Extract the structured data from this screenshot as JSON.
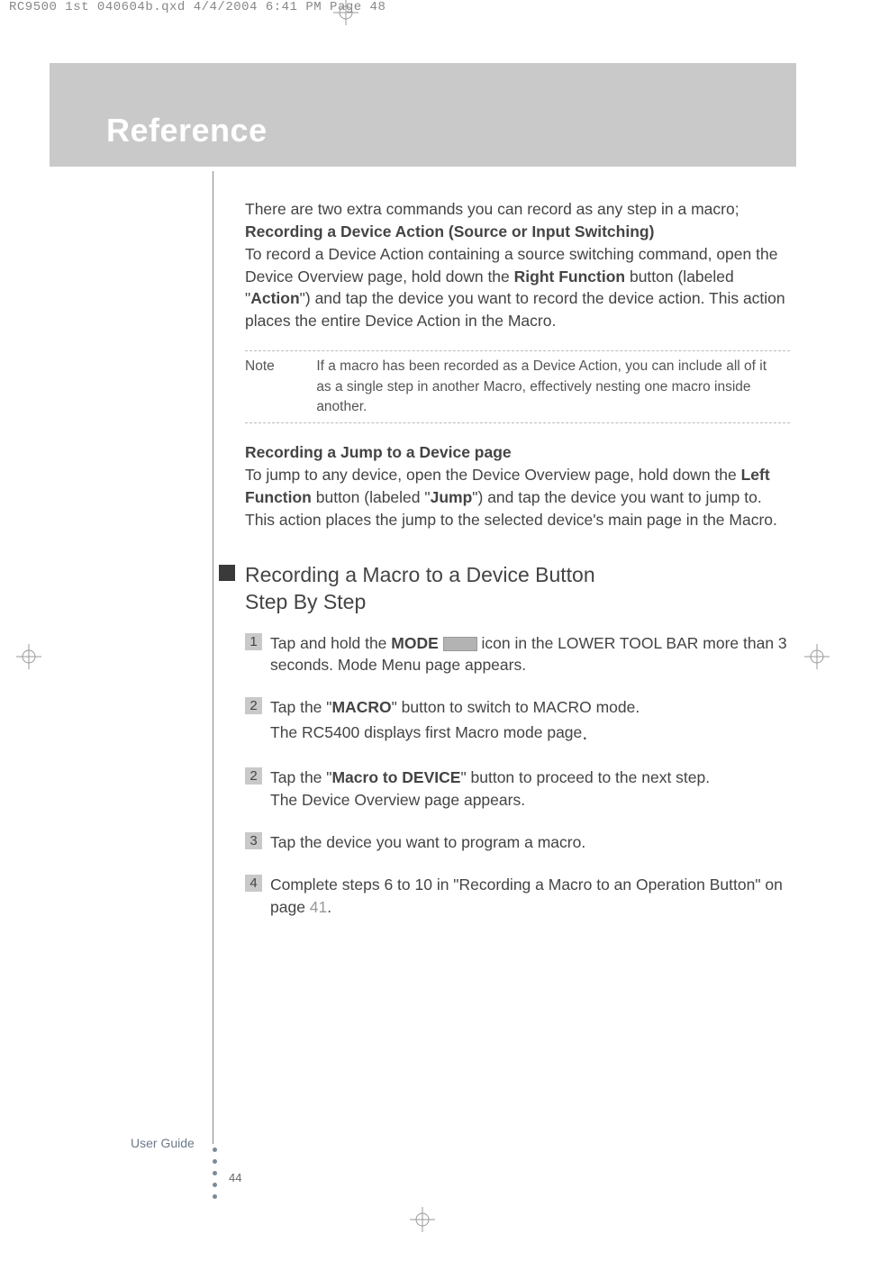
{
  "header": {
    "slug": "RC9500 1st 040604b.qxd  4/4/2004  6:41 PM  Page 48"
  },
  "chapter": "Reference",
  "intro": "There are two extra commands you can record as any step in a macro;",
  "sec1": {
    "title": "Recording a Device Action (Source or Input Switching)",
    "p1_a": "To record a Device Action containing a source switching command, open the Device Overview page, hold down the ",
    "p1_b": "Right Function",
    "p1_c": " button (labeled \"",
    "p1_d": "Action",
    "p1_e": "\") and tap the device you want to record the device action. This action places the entire Device Action in the Macro."
  },
  "note": {
    "label": "Note",
    "text": "If a macro has been recorded as a Device Action, you can include all of it as a single step in another Macro, effectively nesting one macro inside another."
  },
  "sec2": {
    "title": "Recording a Jump to a Device page",
    "p1_a": "To jump to any device, open the Device Overview page, hold down the ",
    "p1_b": "Left Function",
    "p1_c": " button (labeled \"",
    "p1_d": "Jump",
    "p1_e": "\") and tap the device you want to jump to. This action places the jump to the selected device's main page in the Macro."
  },
  "sec3": {
    "title_l1": "Recording a Macro to a Device Button",
    "title_l2": "Step By Step"
  },
  "steps": {
    "s1": {
      "num": "1",
      "a": "Tap and hold the ",
      "b": "MODE",
      "c": " icon in the LOWER TOOL BAR more than 3 seconds. Mode Menu page appears."
    },
    "s2": {
      "num": "2",
      "a": "Tap the \"",
      "b": "MACRO",
      "c": "\" button to switch to MACRO mode.",
      "d": "The RC5400 displays first Macro mode page",
      "e": "."
    },
    "s3": {
      "num": "2",
      "a": "Tap the \"",
      "b": "Macro to DEVICE",
      "c": "\" button to proceed to the next step.",
      "d": "The Device Overview page appears."
    },
    "s4": {
      "num": "3",
      "a": "Tap the device you want to program a macro."
    },
    "s5": {
      "num": "4",
      "a": "Complete steps 6 to 10 in \"Recording a Macro to an Operation Button\" on page ",
      "b": "41",
      "c": "."
    }
  },
  "footer": {
    "guide": "User Guide",
    "page": "44"
  }
}
